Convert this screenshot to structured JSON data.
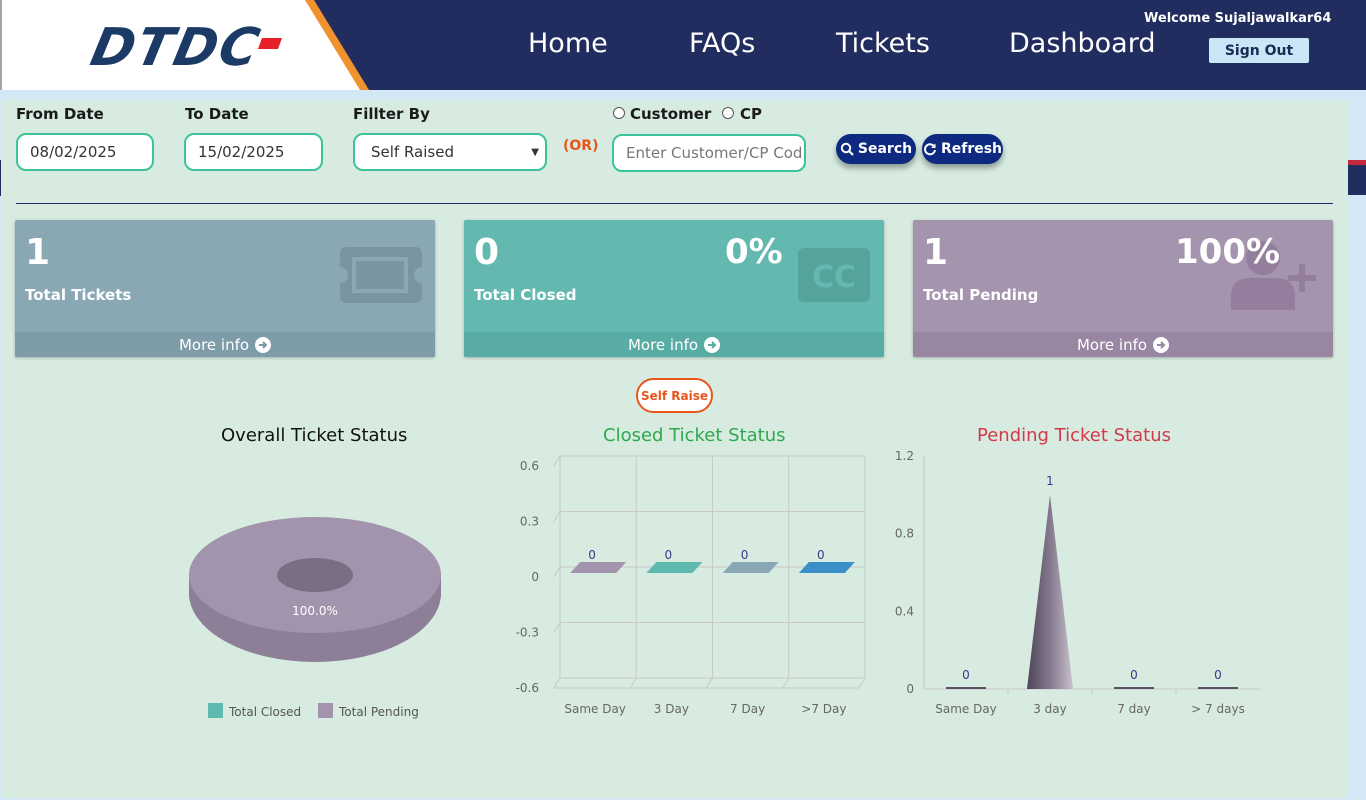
{
  "header": {
    "logo": "DTDC",
    "nav": [
      "Home",
      "FAQs",
      "Tickets",
      "Dashboard"
    ],
    "welcome": "Welcome Sujaljawalkar64",
    "signout": "Sign Out"
  },
  "filters": {
    "from_label": "From Date",
    "from_value": "08/02/2025",
    "to_label": "To Date",
    "to_value": "15/02/2025",
    "filter_label": "Fillter By",
    "filter_value": "Self Raised",
    "or": "(OR)",
    "radio_customer": "Customer",
    "radio_cp": "CP",
    "code_placeholder": "Enter Customer/CP Cod",
    "search": "Search",
    "refresh": "Refresh"
  },
  "cards": [
    {
      "value": "1",
      "percent": "",
      "label": "Total Tickets",
      "more": "More info",
      "color": "#8aa8b4"
    },
    {
      "value": "0",
      "percent": "0%",
      "label": "Total Closed",
      "more": "More info",
      "color": "#63b9b0"
    },
    {
      "value": "1",
      "percent": "100%",
      "label": "Total Pending",
      "more": "More info",
      "color": "#a494ad"
    }
  ],
  "self_raise": "Self Raise",
  "chart_data": [
    {
      "type": "pie",
      "title": "Overall Ticket Status",
      "categories": [
        "Total Closed",
        "Total Pending"
      ],
      "values": [
        0,
        1
      ],
      "data_labels": [
        "",
        "100.0%"
      ],
      "colors": [
        "#5fb9ae",
        "#a294ac"
      ],
      "legend": "bottom"
    },
    {
      "type": "bar",
      "title": "Closed Ticket Status",
      "categories": [
        "Same Day",
        "3 Day",
        "7 Day",
        ">7 Day"
      ],
      "values": [
        0,
        0,
        0,
        0
      ],
      "colors": [
        "#a294ac",
        "#5fb9ae",
        "#8aa8b4",
        "#3b8fc8"
      ],
      "yticks": [
        "0.6",
        "0.3",
        "0",
        "-0.3",
        "-0.6"
      ],
      "ylim": [
        -0.6,
        0.6
      ]
    },
    {
      "type": "bar",
      "title": "Pending Ticket Status",
      "categories": [
        "Same Day",
        "3 day",
        "7 day",
        "> 7 days"
      ],
      "values": [
        0,
        1,
        0,
        0
      ],
      "yticks": [
        "1.2",
        "0.8",
        "0.4",
        "0"
      ],
      "ylim": [
        0,
        1.2
      ]
    }
  ]
}
